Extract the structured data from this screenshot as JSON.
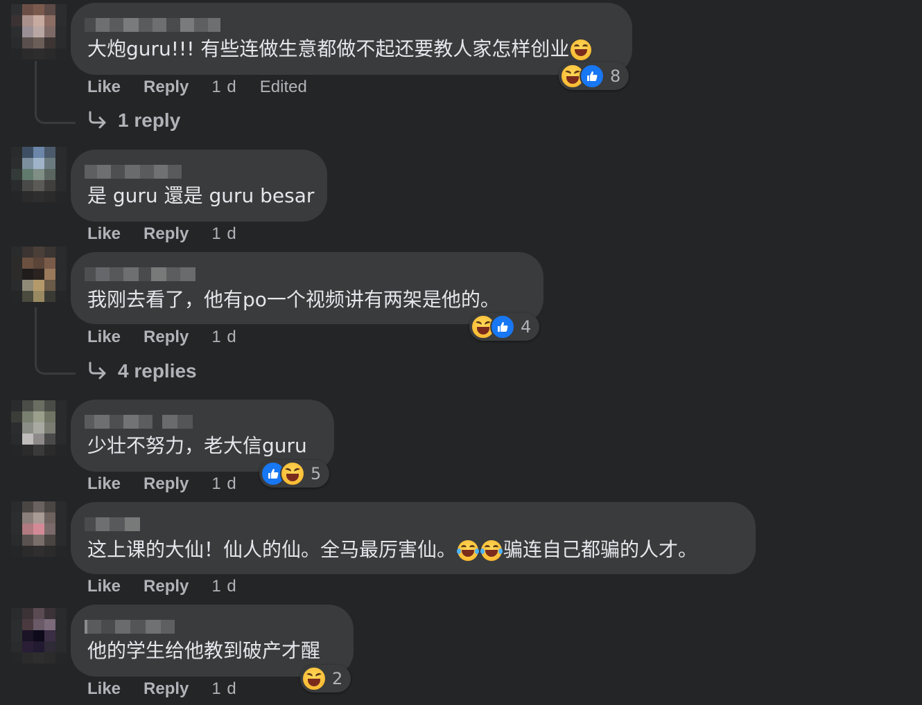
{
  "labels": {
    "like": "Like",
    "reply": "Reply"
  },
  "comments": [
    {
      "text_before": "大炮guru!!! 有些连做生意都做不起还要教人家怎样创业",
      "inline_emoji": [
        "rolling-laughing"
      ],
      "time": "1 d",
      "edited": "Edited",
      "reactions": {
        "types": [
          "haha",
          "like"
        ],
        "count": "8"
      },
      "replies_link": "1 reply"
    },
    {
      "text_before": "是 guru 還是 guru besar",
      "time": "1 d"
    },
    {
      "text_before": "我刚去看了，他有po一个视频讲有两架是他的。",
      "time": "1 d",
      "reactions": {
        "types": [
          "haha",
          "like"
        ],
        "count": "4"
      },
      "replies_link": "4 replies"
    },
    {
      "text_before": "少壮不努力，老大信guru",
      "time": "1 d",
      "reactions": {
        "types": [
          "like",
          "haha"
        ],
        "count": "5"
      }
    },
    {
      "text_before": "这上课的大仙！仙人的仙。全马最厉害仙。",
      "inline_emoji": [
        "tears-of-joy",
        "tears-of-joy"
      ],
      "text_after": "骗连自己都骗的人才。",
      "time": "1 d"
    },
    {
      "text_before": "他的学生给他教到破产才醒",
      "time": "1 d",
      "reactions": {
        "types": [
          "haha"
        ],
        "count": "2"
      }
    }
  ],
  "colors": {
    "background": "#242526",
    "bubble": "#3a3b3c",
    "primary_text": "#e4e6eb",
    "secondary_text": "#b0b3b8",
    "like_blue": "#1877f2",
    "haha_yellow": "#f7b125"
  }
}
